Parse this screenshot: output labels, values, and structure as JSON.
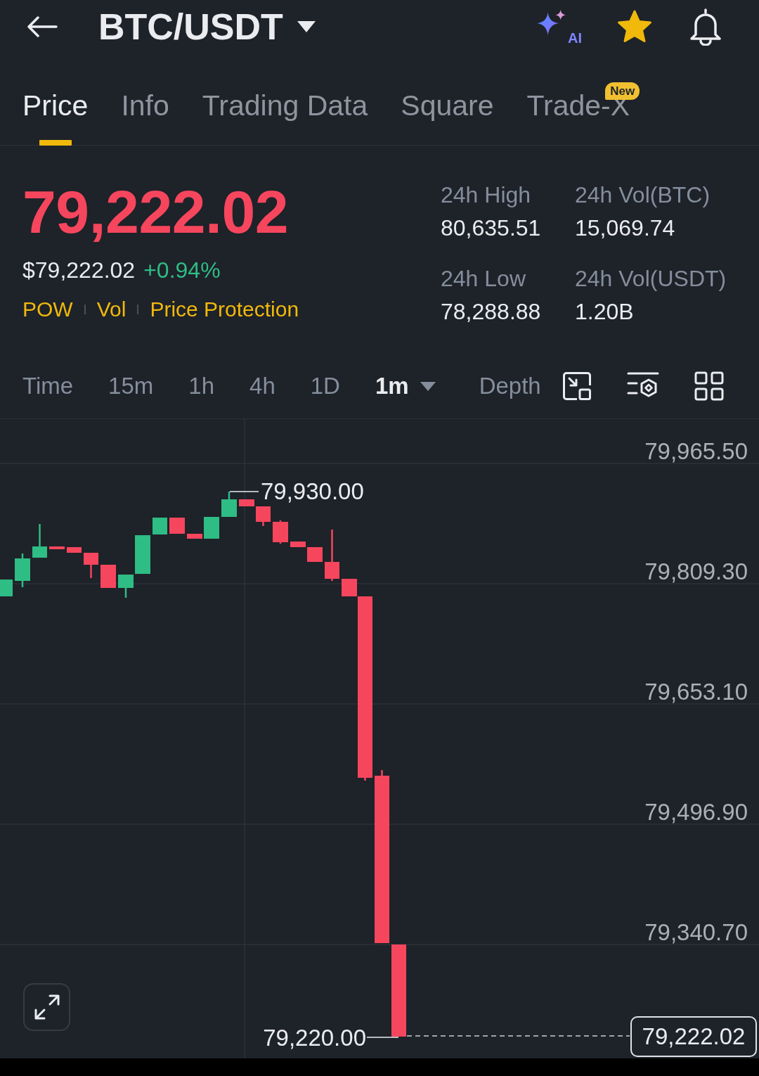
{
  "header": {
    "pair": "BTC/USDT",
    "ai_label": "AI",
    "favorite": true
  },
  "tabs": [
    {
      "label": "Price",
      "selected": true
    },
    {
      "label": "Info",
      "selected": false
    },
    {
      "label": "Trading Data",
      "selected": false
    },
    {
      "label": "Square",
      "selected": false
    },
    {
      "label": "Trade-X",
      "selected": false,
      "badge": "New"
    }
  ],
  "ticker": {
    "last_price": "79,222.02",
    "price_up": false,
    "fiat_price": "$79,222.02",
    "change": "+0.94%",
    "change_up": true,
    "tags": [
      "POW",
      "Vol",
      "Price Protection"
    ],
    "stats": [
      {
        "label": "24h High",
        "value": "80,635.51"
      },
      {
        "label": "24h Vol(BTC)",
        "value": "15,069.74"
      },
      {
        "label": "24h Low",
        "value": "78,288.88"
      },
      {
        "label": "24h Vol(USDT)",
        "value": "1.20B"
      }
    ]
  },
  "toolbar": [
    {
      "label": "Time",
      "selected": false,
      "dropdown": false
    },
    {
      "label": "15m",
      "selected": false,
      "dropdown": false
    },
    {
      "label": "1h",
      "selected": false,
      "dropdown": false
    },
    {
      "label": "4h",
      "selected": false,
      "dropdown": false
    },
    {
      "label": "1D",
      "selected": false,
      "dropdown": false
    },
    {
      "label": "1m",
      "selected": true,
      "dropdown": true
    },
    {
      "label": "Depth",
      "selected": false,
      "dropdown": false
    }
  ],
  "chart": {
    "price_axis": [
      "79,965.50",
      "79,809.30",
      "79,653.10",
      "79,496.90",
      "79,340.70"
    ],
    "high_label": "79,930.00",
    "low_label": "79,220.00",
    "last_price_tag": "79,222.02"
  }
}
